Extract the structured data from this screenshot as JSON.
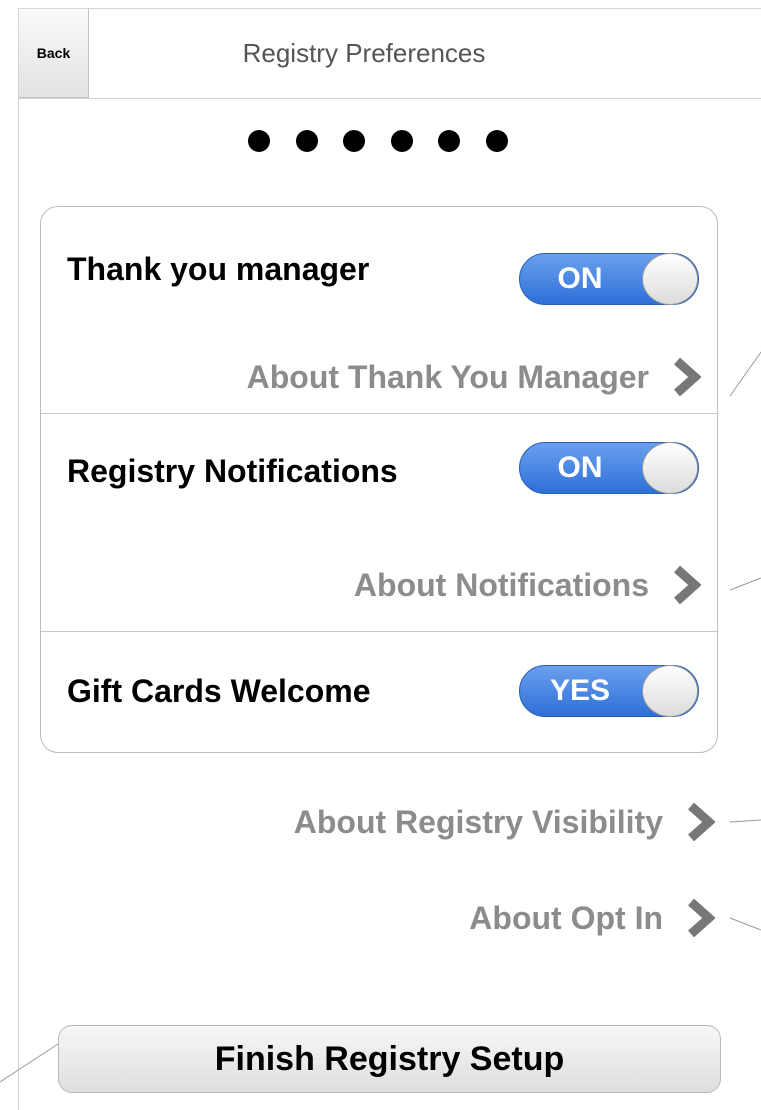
{
  "navbar": {
    "back_label": "Back",
    "title": "Registry Preferences"
  },
  "progress": {
    "dot_count": 6
  },
  "settings": [
    {
      "label": "Thank you manager",
      "toggle": "ON",
      "on": true
    },
    {
      "link": "About Thank You Manager"
    },
    {
      "label": "Registry Notifications",
      "toggle": "ON",
      "on": true
    },
    {
      "link": "About Notifications"
    },
    {
      "label": "Gift Cards Welcome",
      "toggle": "YES",
      "on": true
    }
  ],
  "links": {
    "visibility": "About Registry Visibility",
    "opt_in": "About Opt In"
  },
  "finish_button": "Finish Registry Setup",
  "icons": {
    "chevron": "chevron-right-icon",
    "toggle_knob": "toggle-knob"
  },
  "colors": {
    "toggle_blue": "#2e6fd8",
    "link_gray": "#8c8c8c"
  }
}
